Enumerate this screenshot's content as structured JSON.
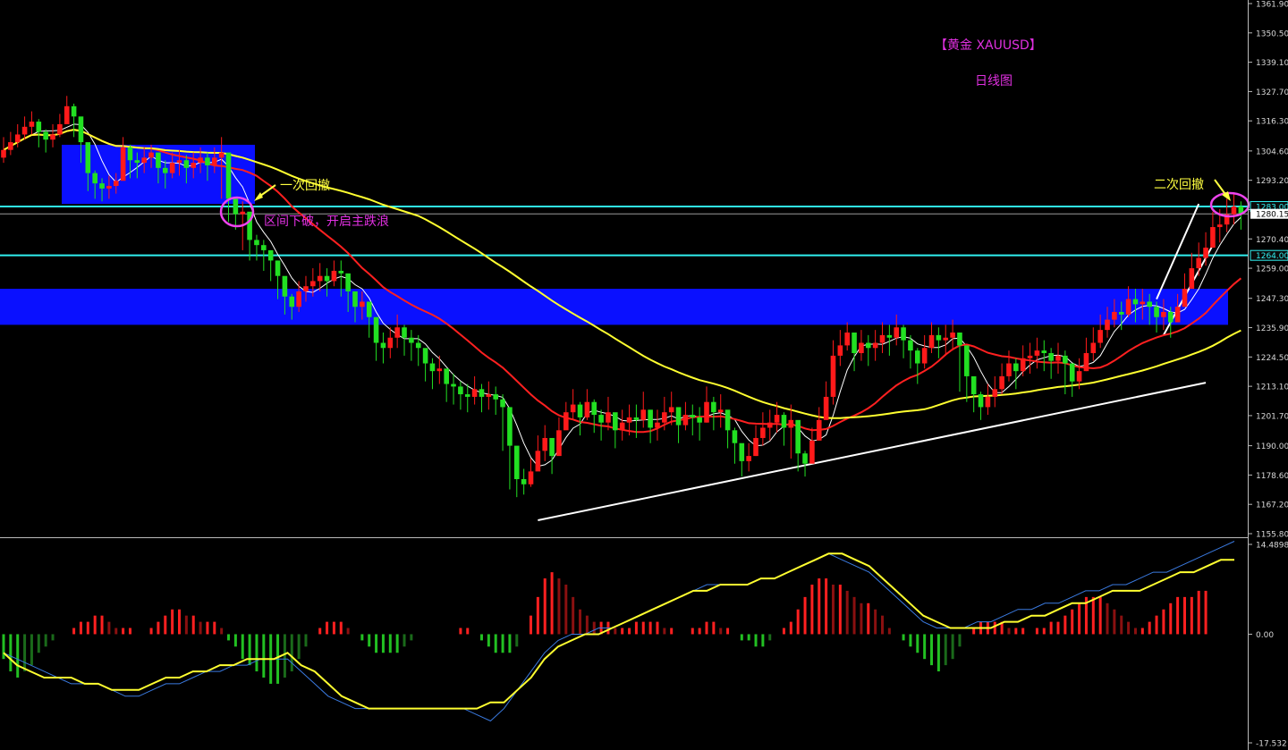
{
  "title": {
    "main": "【黄金 XAUUSD】",
    "sub": "日线图"
  },
  "annotations": {
    "first_pullback": "一次回撤",
    "second_pullback": "二次回撤",
    "breakdown": "区间下破，开启主跌浪"
  },
  "colors": {
    "background": "#000000",
    "bull_candle": "#ff1a1a",
    "bear_candle": "#22e022",
    "ma_fast": "#ffffff",
    "ma_mid": "#ff2020",
    "ma_slow": "#ffff30",
    "zone_fill": "#0a10ff",
    "level_line": "#30f0f0",
    "trendline": "#ffffff",
    "highlight_circle": "#ee44ee",
    "arrow": "#ffff40"
  },
  "chart_data": [
    {
      "type": "candlestick",
      "symbol": "XAUUSD",
      "timeframe": "daily",
      "y_ticks": [
        "1361.90",
        "1350.50",
        "1339.10",
        "1327.70",
        "1316.30",
        "1304.60",
        "1293.20",
        "1281.80",
        "1270.40",
        "1259.00",
        "1247.30",
        "1235.90",
        "1224.50",
        "1213.10",
        "1201.70",
        "1190.00",
        "1178.60",
        "1167.20",
        "1155.80"
      ],
      "ylim": [
        1155.8,
        1361.9
      ],
      "price_markers": [
        {
          "label": "1283.00",
          "value": 1283.0,
          "style": "level-line"
        },
        {
          "label": "1280.15",
          "value": 1280.15,
          "style": "current-price"
        },
        {
          "label": "1264.00",
          "value": 1264.0,
          "style": "level-line"
        }
      ],
      "zones": [
        {
          "name": "consolidation range (early)",
          "from_bar": 0,
          "to_bar": 25,
          "low": 1284,
          "high": 1307
        },
        {
          "name": "support/resistance band",
          "from_bar": 0,
          "to_bar": 173,
          "low": 1237,
          "high": 1251
        }
      ],
      "trendlines": [
        {
          "name": "rising support",
          "points": [
            [
              76,
              1161
            ],
            [
              171,
              1214.5
            ]
          ]
        },
        {
          "name": "channel upper",
          "points": [
            [
              164,
              1247
            ],
            [
              170,
              1284
            ]
          ]
        },
        {
          "name": "channel lower",
          "points": [
            [
              165,
              1233
            ],
            [
              172,
              1268
            ]
          ]
        }
      ],
      "close": [
        1305,
        1308,
        1311,
        1314,
        1316,
        1312,
        1309,
        1311,
        1315,
        1322,
        1318,
        1308,
        1296,
        1292,
        1290,
        1291,
        1293,
        1306,
        1301,
        1300,
        1302,
        1304,
        1298,
        1296,
        1300,
        1301,
        1298,
        1300,
        1302,
        1299,
        1302,
        1304,
        1286,
        1280,
        1281,
        1270,
        1268,
        1266,
        1262,
        1256,
        1248,
        1244,
        1250,
        1252,
        1254,
        1256,
        1254,
        1258,
        1257,
        1250,
        1244,
        1246,
        1240,
        1230,
        1228,
        1232,
        1236,
        1232,
        1230,
        1228,
        1222,
        1219,
        1220,
        1214,
        1213,
        1210,
        1209,
        1212,
        1209,
        1210,
        1208,
        1205,
        1190,
        1177,
        1175,
        1180,
        1188,
        1193,
        1186,
        1196,
        1203,
        1206,
        1201,
        1207,
        1202,
        1199,
        1203,
        1196,
        1199,
        1201,
        1200,
        1204,
        1197,
        1199,
        1203,
        1205,
        1198,
        1202,
        1201,
        1199,
        1207,
        1203,
        1204,
        1196,
        1191,
        1184,
        1186,
        1193,
        1197,
        1199,
        1202,
        1197,
        1200,
        1187,
        1183,
        1192,
        1200,
        1209,
        1225,
        1229,
        1234,
        1226,
        1230,
        1228,
        1230,
        1233,
        1232,
        1236,
        1231,
        1227,
        1222,
        1228,
        1233,
        1231,
        1232,
        1234,
        1229,
        1217,
        1210,
        1205,
        1209,
        1212,
        1217,
        1222,
        1219,
        1224,
        1225,
        1227,
        1226,
        1223,
        1225,
        1222,
        1215,
        1219,
        1226,
        1230,
        1235,
        1239,
        1242,
        1241,
        1247,
        1245,
        1246,
        1244,
        1240,
        1242,
        1238,
        1244,
        1251,
        1259,
        1263,
        1267,
        1275,
        1276,
        1280,
        1283,
        1280.15
      ],
      "bars_high": [
        1310,
        1312,
        1315,
        1318,
        1320,
        1317,
        1313,
        1315,
        1319,
        1326,
        1323,
        1314,
        1302,
        1297,
        1294,
        1295,
        1296,
        1310,
        1307,
        1304,
        1306,
        1307,
        1303,
        1301,
        1304,
        1305,
        1303,
        1304,
        1306,
        1304,
        1306,
        1310,
        1296,
        1284,
        1285,
        1274,
        1272,
        1270,
        1266,
        1262,
        1253,
        1249,
        1254,
        1256,
        1259,
        1261,
        1259,
        1262,
        1262,
        1256,
        1250,
        1250,
        1246,
        1236,
        1234,
        1236,
        1241,
        1237,
        1235,
        1233,
        1227,
        1224,
        1225,
        1219,
        1218,
        1215,
        1214,
        1217,
        1214,
        1215,
        1213,
        1210,
        1198,
        1184,
        1181,
        1185,
        1194,
        1198,
        1192,
        1201,
        1207,
        1212,
        1207,
        1212,
        1208,
        1204,
        1209,
        1201,
        1204,
        1206,
        1206,
        1211,
        1203,
        1204,
        1209,
        1211,
        1204,
        1207,
        1206,
        1205,
        1213,
        1209,
        1210,
        1202,
        1197,
        1190,
        1191,
        1198,
        1203,
        1204,
        1207,
        1203,
        1206,
        1193,
        1188,
        1197,
        1205,
        1215,
        1231,
        1235,
        1238,
        1231,
        1235,
        1233,
        1235,
        1238,
        1237,
        1241,
        1237,
        1233,
        1228,
        1233,
        1238,
        1236,
        1237,
        1239,
        1234,
        1223,
        1216,
        1211,
        1214,
        1217,
        1222,
        1227,
        1224,
        1229,
        1230,
        1232,
        1231,
        1228,
        1230,
        1227,
        1220,
        1224,
        1232,
        1236,
        1241,
        1244,
        1247,
        1246,
        1252,
        1251,
        1251,
        1249,
        1246,
        1247,
        1244,
        1249,
        1257,
        1265,
        1269,
        1273,
        1281,
        1282,
        1286,
        1288,
        1285
      ],
      "bars_low": [
        1300,
        1303,
        1306,
        1309,
        1311,
        1306,
        1304,
        1306,
        1310,
        1316,
        1310,
        1300,
        1289,
        1286,
        1285,
        1286,
        1288,
        1294,
        1294,
        1294,
        1296,
        1298,
        1292,
        1290,
        1294,
        1295,
        1292,
        1294,
        1296,
        1293,
        1296,
        1286,
        1277,
        1274,
        1266,
        1262,
        1262,
        1258,
        1254,
        1247,
        1241,
        1239,
        1242,
        1246,
        1248,
        1250,
        1248,
        1252,
        1248,
        1242,
        1238,
        1239,
        1232,
        1223,
        1222,
        1224,
        1228,
        1225,
        1223,
        1221,
        1215,
        1212,
        1214,
        1207,
        1206,
        1204,
        1203,
        1206,
        1203,
        1204,
        1202,
        1188,
        1173,
        1170,
        1171,
        1174,
        1181,
        1184,
        1179,
        1189,
        1197,
        1200,
        1194,
        1200,
        1195,
        1192,
        1196,
        1189,
        1192,
        1194,
        1193,
        1197,
        1191,
        1192,
        1196,
        1198,
        1191,
        1196,
        1194,
        1192,
        1199,
        1196,
        1197,
        1189,
        1183,
        1178,
        1180,
        1186,
        1190,
        1192,
        1195,
        1190,
        1185,
        1180,
        1178,
        1185,
        1192,
        1200,
        1206,
        1221,
        1227,
        1219,
        1223,
        1221,
        1223,
        1226,
        1225,
        1229,
        1224,
        1220,
        1214,
        1220,
        1226,
        1224,
        1225,
        1227,
        1211,
        1207,
        1203,
        1200,
        1202,
        1205,
        1210,
        1215,
        1212,
        1217,
        1218,
        1220,
        1219,
        1216,
        1218,
        1210,
        1209,
        1212,
        1219,
        1223,
        1228,
        1232,
        1236,
        1235,
        1240,
        1238,
        1239,
        1237,
        1234,
        1235,
        1232,
        1238,
        1244,
        1252,
        1256,
        1260,
        1267,
        1269,
        1273,
        1276,
        1274
      ]
    },
    {
      "type": "bar+line",
      "name": "oscillator",
      "y_ticks": [
        "14.4898",
        "0.00",
        "-17.532"
      ],
      "ylim": [
        -17.532,
        14.4898
      ],
      "histogram": [
        -4,
        -6,
        -7,
        -6,
        -5,
        -3,
        -2,
        -1,
        0,
        0,
        1,
        2,
        2,
        3,
        3,
        2,
        1,
        1,
        1,
        0,
        0,
        1,
        2,
        3,
        4,
        4,
        3,
        3,
        2,
        2,
        2,
        1,
        -1,
        -2,
        -4,
        -5,
        -6,
        -7,
        -8,
        -8,
        -7,
        -6,
        -4,
        -2,
        0,
        1,
        2,
        2,
        2,
        1,
        0,
        -1,
        -2,
        -3,
        -3,
        -3,
        -3,
        -2,
        -1,
        0,
        0,
        0,
        0,
        0,
        0,
        1,
        1,
        0,
        -1,
        -2,
        -3,
        -3,
        -3,
        -2,
        0,
        3,
        6,
        9,
        10,
        9,
        8,
        6,
        4,
        3,
        2,
        2,
        2,
        1,
        1,
        1,
        2,
        2,
        2,
        2,
        1,
        1,
        0,
        0,
        1,
        1,
        2,
        2,
        1,
        1,
        0,
        -1,
        -1,
        -2,
        -2,
        -1,
        0,
        1,
        2,
        4,
        6,
        8,
        9,
        9,
        8,
        8,
        7,
        6,
        5,
        5,
        4,
        3,
        1,
        0,
        -1,
        -2,
        -3,
        -4,
        -5,
        -6,
        -5,
        -4,
        -2,
        0,
        1,
        2,
        2,
        2,
        2,
        1,
        1,
        1,
        0,
        1,
        1,
        2,
        2,
        3,
        4,
        5,
        6,
        6,
        6,
        5,
        4,
        3,
        2,
        1,
        1,
        2,
        3,
        4,
        5,
        6,
        6,
        6,
        7,
        7
      ],
      "signal_line": [
        -3,
        -5,
        -6,
        -7,
        -7,
        -7,
        -8,
        -8,
        -9,
        -9,
        -9,
        -8,
        -7,
        -7,
        -6,
        -6,
        -5,
        -5,
        -4,
        -4,
        -4,
        -3,
        -5,
        -6,
        -8,
        -10,
        -11,
        -12,
        -12,
        -12,
        -12,
        -12,
        -12,
        -12,
        -12,
        -12,
        -11,
        -11,
        -9,
        -7,
        -4,
        -2,
        -1,
        0,
        0,
        1,
        2,
        3,
        4,
        5,
        6,
        7,
        7,
        8,
        8,
        8,
        9,
        9,
        10,
        11,
        12,
        13,
        13,
        12,
        11,
        9,
        7,
        5,
        3,
        2,
        1,
        1,
        1,
        1,
        2,
        2,
        3,
        3,
        4,
        5,
        5,
        6,
        7,
        7,
        7,
        8,
        9,
        10,
        10,
        11,
        12,
        12
      ],
      "main_line": [
        -3,
        -4,
        -5,
        -6,
        -7,
        -8,
        -8,
        -8,
        -9,
        -10,
        -10,
        -9,
        -8,
        -8,
        -7,
        -6,
        -6,
        -5,
        -5,
        -4,
        -4,
        -4,
        -6,
        -8,
        -10,
        -11,
        -12,
        -12,
        -12,
        -12,
        -12,
        -12,
        -12,
        -12,
        -12,
        -13,
        -14,
        -12,
        -9,
        -6,
        -3,
        -1,
        0,
        0,
        1,
        1,
        2,
        3,
        4,
        5,
        6,
        7,
        8,
        8,
        8,
        8,
        9,
        9,
        10,
        11,
        12,
        13,
        12,
        11,
        10,
        8,
        6,
        4,
        2,
        1,
        1,
        1,
        2,
        2,
        3,
        4,
        4,
        5,
        5,
        6,
        7,
        7,
        8,
        8,
        9,
        10,
        10,
        11,
        12,
        13,
        14,
        15
      ]
    }
  ]
}
